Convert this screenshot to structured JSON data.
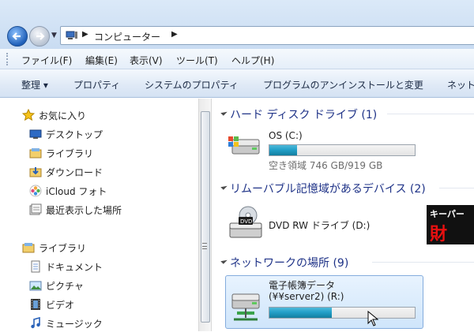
{
  "address": {
    "path": [
      "コンピューター"
    ]
  },
  "menu": [
    "ファイル(F)",
    "編集(E)",
    "表示(V)",
    "ツール(T)",
    "ヘルプ(H)"
  ],
  "commands": [
    "整理 ▾",
    "プロパティ",
    "システムのプロパティ",
    "プログラムのアンインストールと変更",
    "ネット"
  ],
  "nav": {
    "favorites": [
      "お気に入り",
      "デスクトップ",
      "ライブラリ",
      "ダウンロード",
      "iCloud フォト",
      "最近表示した場所"
    ],
    "libraries": [
      "ライブラリ",
      "ドキュメント",
      "ピクチャ",
      "ビデオ",
      "ミュージック"
    ]
  },
  "groups": [
    {
      "title": "ハード ディスク ドライブ (1)"
    },
    {
      "title": "リムーバブル記憶域があるデバイス (2)"
    },
    {
      "title": "ネットワークの場所 (9)"
    }
  ],
  "drives": {
    "os": {
      "name": "OS (C:)",
      "free_text": "空き領域 746 GB/919 GB",
      "used_fraction": 0.19
    },
    "dvd": {
      "name": "DVD RW ドライブ (D:)"
    },
    "net": {
      "name1": "電子帳簿データ",
      "name2": "(¥¥server2) (R:)",
      "used_fraction": 0.43
    }
  },
  "thumb": {
    "line1": "キーパー",
    "line2": "財"
  },
  "colors": {
    "accent": "#1e3287",
    "bar": "#23a0c9",
    "selection": "#cfe5fb"
  }
}
